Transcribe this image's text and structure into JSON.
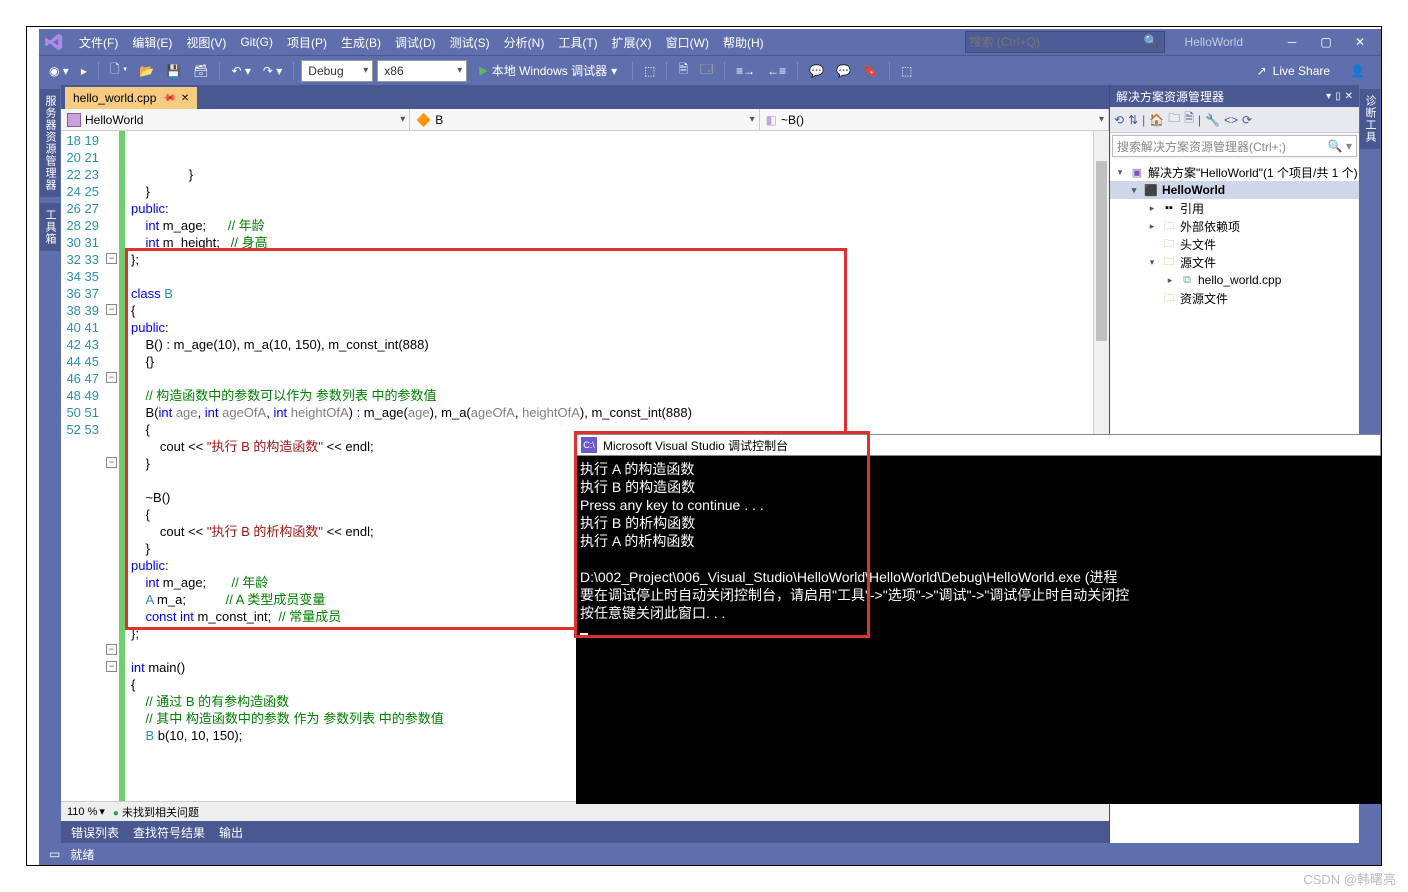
{
  "menu": {
    "items": [
      "文件(F)",
      "编辑(E)",
      "视图(V)",
      "Git(G)",
      "项目(P)",
      "生成(B)",
      "调试(D)",
      "测试(S)",
      "分析(N)",
      "工具(T)",
      "扩展(X)",
      "窗口(W)",
      "帮助(H)"
    ],
    "search_placeholder": "搜索 (Ctrl+Q)",
    "solution_name": "HelloWorld"
  },
  "toolbar": {
    "config": "Debug",
    "platform": "x86",
    "start_label": "本地 Windows 调试器",
    "live_share": "Live Share"
  },
  "side_tabs": {
    "left1": "服务器资源管理器",
    "left2": "工具箱",
    "right1": "诊断工具"
  },
  "doc_tab": {
    "filename": "hello_world.cpp"
  },
  "nav": {
    "project": "HelloWorld",
    "class": "B",
    "member": "~B()"
  },
  "editor": {
    "lines_start": 18,
    "lines_end": 53,
    "zoom": "110 %",
    "no_issues": "未找到相关问题"
  },
  "code": {
    "c_age": "// 年龄",
    "c_height": "// 身高",
    "c_param": "// 构造函数中的参数可以作为 参数列表 中的参数值",
    "s_ctor": "\"执行 B 的构造函数\"",
    "s_dtor": "\"执行 B 的析构函数\"",
    "c_age2": "// 年龄",
    "c_a_member": "// A 类型成员变量",
    "c_const": "// 常量成员",
    "c_main1": "// 通过 B 的有参构造函数",
    "c_main2": "// 其中 构造函数中的参数 作为 参数列表 中的参数值"
  },
  "fold_boxes": [
    {
      "line": 25,
      "sym": "−"
    },
    {
      "line": 28,
      "sym": "−"
    },
    {
      "line": 32,
      "sym": "−"
    },
    {
      "line": 37,
      "sym": "−"
    },
    {
      "line": 48,
      "sym": "−"
    },
    {
      "line": 49,
      "sym": "−"
    }
  ],
  "bottom_tabs": [
    "错误列表",
    "查找符号结果",
    "输出"
  ],
  "statusbar": {
    "ready": "就绪"
  },
  "solution_explorer": {
    "title": "解决方案资源管理器",
    "search_placeholder": "搜索解决方案资源管理器(Ctrl+;)",
    "root": "解决方案\"HelloWorld\"(1 个项目/共 1 个)",
    "project": "HelloWorld",
    "refs": "引用",
    "ext_deps": "外部依赖项",
    "headers": "头文件",
    "sources": "源文件",
    "file": "hello_world.cpp",
    "resources": "资源文件"
  },
  "console": {
    "title": "Microsoft Visual Studio 调试控制台",
    "lines": [
      "执行 A 的构造函数",
      "执行 B 的构造函数",
      "Press any key to continue . . .",
      "执行 B 的析构函数",
      "执行 A 的析构函数",
      "",
      "D:\\002_Project\\006_Visual_Studio\\HelloWorld\\HelloWorld\\Debug\\HelloWorld.exe (进程",
      "要在调试停止时自动关闭控制台，请启用\"工具\"->\"选项\"->\"调试\"->\"调试停止时自动关闭控",
      "按任意键关闭此窗口. . ."
    ]
  },
  "watermark": "CSDN @韩曙亮"
}
